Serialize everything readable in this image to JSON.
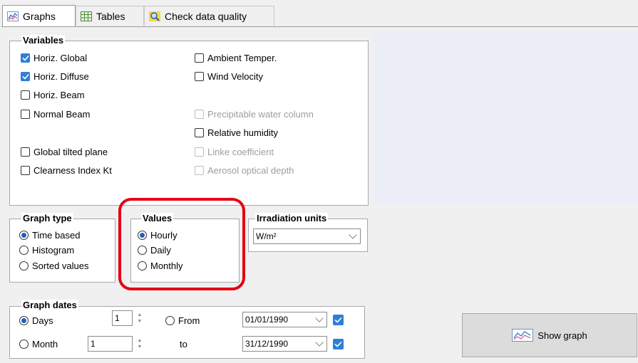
{
  "tabs": [
    {
      "label": "Graphs",
      "icon": "line-chart-icon",
      "active": true
    },
    {
      "label": "Tables",
      "icon": "table-icon",
      "active": false
    },
    {
      "label": "Check data quality",
      "icon": "magnifier-icon",
      "active": false
    }
  ],
  "variables": {
    "title": "Variables",
    "left": [
      {
        "label": "Horiz. Global",
        "checked": true
      },
      {
        "label": "Horiz. Diffuse",
        "checked": true
      },
      {
        "label": "Horiz. Beam",
        "checked": false
      },
      {
        "label": "Normal Beam",
        "checked": false
      },
      {
        "label": "Global tilted plane",
        "checked": false
      },
      {
        "label": "Clearness Index Kt",
        "checked": false
      }
    ],
    "right": [
      {
        "label": "Ambient Temper.",
        "checked": false,
        "enabled": true
      },
      {
        "label": "Wind Velocity",
        "checked": false,
        "enabled": true
      },
      {
        "label": "Precipitable water column",
        "checked": false,
        "enabled": false
      },
      {
        "label": "Relative humidity",
        "checked": false,
        "enabled": true
      },
      {
        "label": "Linke coefficient",
        "checked": false,
        "enabled": false
      },
      {
        "label": "Aerosol optical depth",
        "checked": false,
        "enabled": false
      }
    ]
  },
  "graph_type": {
    "title": "Graph type",
    "options": [
      "Time based",
      "Histogram",
      "Sorted values"
    ],
    "selected": "Time based"
  },
  "values": {
    "title": "Values",
    "options": [
      "Hourly",
      "Daily",
      "Monthly"
    ],
    "selected": "Hourly"
  },
  "irradiation_units": {
    "title": "Irradiation units",
    "value": "W/m²"
  },
  "graph_dates": {
    "title": "Graph dates",
    "days_label": "Days",
    "days_value": "1",
    "month_label": "Month",
    "month_value": "1",
    "from_label": "From",
    "to_label": "to",
    "from_date": "01/01/1990",
    "to_date": "31/12/1990",
    "selected": "Days"
  },
  "show_graph": {
    "label": "Show graph"
  },
  "colors": {
    "accent": "#2f7fd6",
    "highlight": "#e30613",
    "preview": "#ebeef7"
  }
}
